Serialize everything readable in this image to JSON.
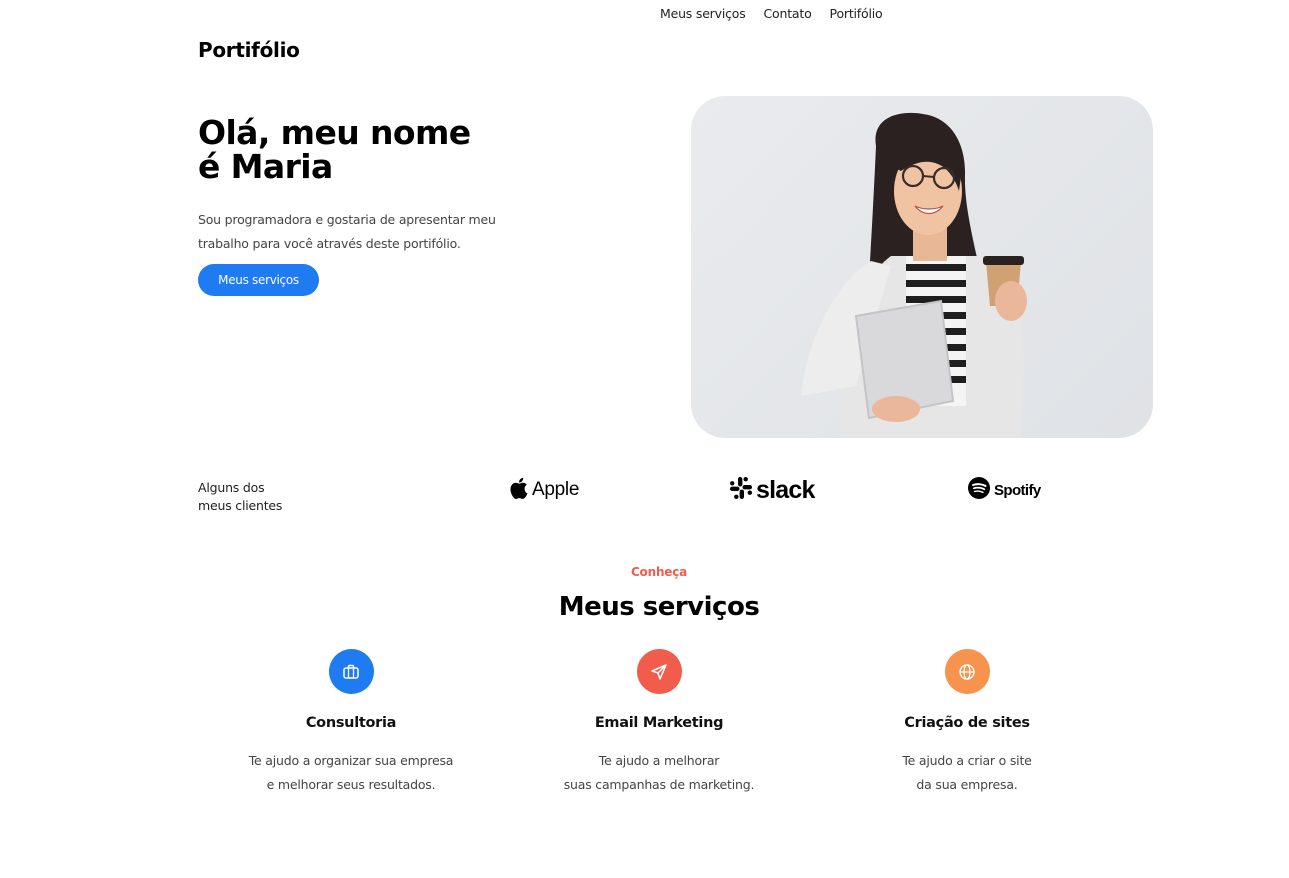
{
  "nav": {
    "items": [
      "Meus serviços",
      "Contato",
      "Portifólio"
    ]
  },
  "brand": "Portifólio",
  "hero": {
    "title_line1": "Olá, meu nome",
    "title_line2": "é Maria",
    "desc_line1": "Sou programadora e gostaria de apresentar meu",
    "desc_line2": "trabalho para você através deste portifólio.",
    "button_label": "Meus serviços"
  },
  "clients": {
    "label_line1": "Alguns dos",
    "label_line2": "meus clientes",
    "logos": [
      {
        "name": "Apple",
        "icon": "apple-icon"
      },
      {
        "name": "slack",
        "icon": "slack-icon"
      },
      {
        "name": "Spotify",
        "icon": "spotify-icon"
      }
    ]
  },
  "services": {
    "eyebrow": "Conheça",
    "title": "Meus serviços",
    "items": [
      {
        "title": "Consultoria",
        "icon": "briefcase-icon",
        "color": "#1f7bf2",
        "desc_line1": "Te ajudo a organizar sua empresa",
        "desc_line2": "e melhorar seus resultados."
      },
      {
        "title": "Email Marketing",
        "icon": "send-icon",
        "color": "#f25c4b",
        "desc_line1": "Te ajudo a melhorar",
        "desc_line2": "suas campanhas de marketing."
      },
      {
        "title": "Criação de sites",
        "icon": "globe-icon",
        "color": "#f7934c",
        "desc_line1": "Te ajudo a criar o site",
        "desc_line2": "da sua empresa."
      }
    ]
  },
  "colors": {
    "accent": "#1f7bf2",
    "eyebrow": "#f25c4b"
  }
}
